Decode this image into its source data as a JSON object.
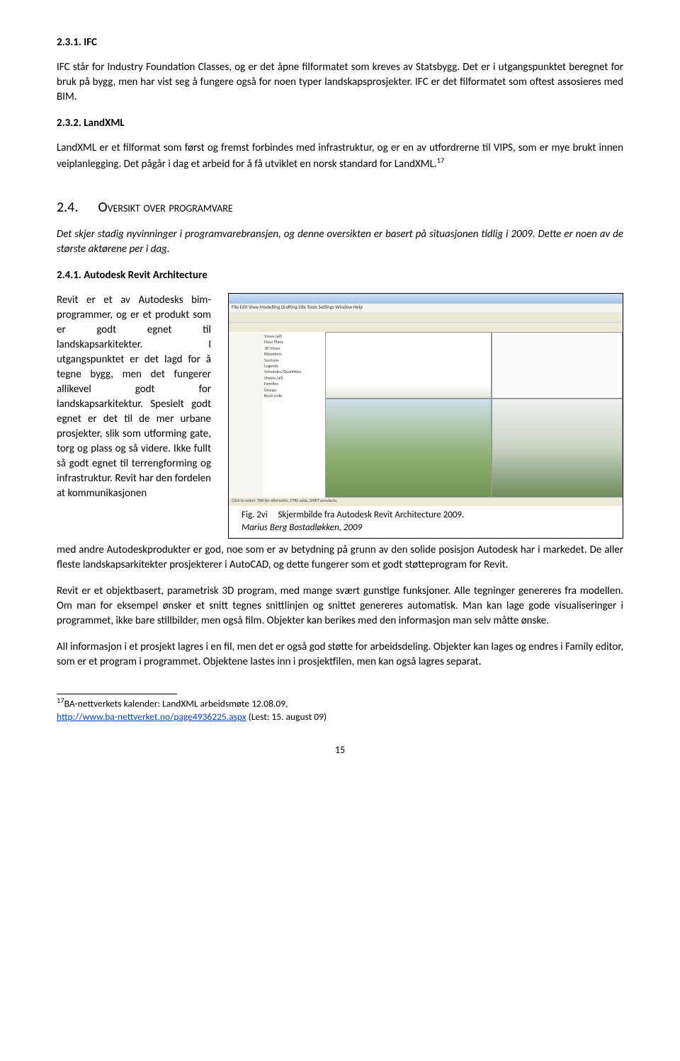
{
  "s1": {
    "heading": "2.3.1. IFC",
    "para": "IFC står for Industry Foundation Classes, og er det åpne filformatet som kreves av Statsbygg. Det er i utgangspunktet beregnet for bruk på bygg, men har vist seg å fungere også for noen typer landskapsprosjekter. IFC er det filformatet som oftest assosieres med BIM."
  },
  "s2": {
    "heading": "2.3.2. LandXML",
    "para": "LandXML er et filformat som først og fremst forbindes med infrastruktur, og er en av utfordrerne til VIPS, som er mye brukt innen veiplanlegging. Det pågår i dag et arbeid for å få utviklet en norsk standard for LandXML.",
    "ref": "17"
  },
  "s3": {
    "num": "2.4.",
    "title": "Oversikt over programvare",
    "intro": "Det skjer stadig nyvinninger i programvarebransjen, og denne oversikten er basert på situasjonen tidlig i 2009. Dette er noen av de største aktørene per i dag."
  },
  "s4": {
    "heading": "2.4.1. Autodesk Revit Architecture",
    "col": "Revit er et av Autodesks bim-programmer, og er et produkt som er godt egnet til landskapsarkitekter. I utgangspunktet er det lagd for å tegne bygg, men det fungerer allikevel godt for landskapsarkitektur. Spesielt godt egnet er det til de mer urbane prosjekter, slik som utforming gate, torg og plass og så videre. Ikke fullt så godt egnet til terrengforming og infrastruktur. Revit har den fordelen at kommunikasjonen",
    "after": "med andre Autodeskprodukter er god, noe som er av betydning på grunn av den solide posisjon Autodesk har i markedet. De aller fleste landskapsarkitekter prosjekterer i AutoCAD, og dette fungerer som et godt støtteprogram for Revit.",
    "p2": "Revit er et objektbasert, parametrisk 3D program, med mange svært gunstige funksjoner. Alle tegninger genereres fra modellen. Om man for eksempel ønsker et snitt tegnes snittlinjen og snittet genereres automatisk. Man kan lage gode visualiseringer i programmet, ikke bare stillbilder, men også film. Objekter kan berikes med den informasjon man selv måtte ønske.",
    "p3": "All informasjon i et prosjekt lagres i en fil, men det er også god støtte for arbeidsdeling. Objekter kan lages og endres i Family editor, som er et program i programmet. Objektene lastes inn i prosjektfilen, men kan også lagres separat."
  },
  "fig": {
    "label": "Fig. 2vi",
    "caption": "Skjermbilde fra Autodesk Revit Architecture 2009.",
    "source": "Marius Berg Bostadløkken, 2009",
    "menu": "File  Edit  View  Modelling  Drafting  Site  Tools  Settings  Window  Help",
    "status": "Click to select, TAB for alternates, CTRL adds, SHIFT unselects.",
    "tree": [
      "Views (all)",
      "Floor Plans",
      "3D Views",
      "Elevations",
      "Sections",
      "Legends",
      "Schedules/Quantities",
      "Sheets (all)",
      "Families",
      "Groups",
      "Revit Links"
    ]
  },
  "footnote": {
    "num": "17",
    "text": "BA-nettverkets kalender: LandXML arbeidsmøte 12.08.09,",
    "url": "http://www.ba-nettverket.no/page4936225.aspx",
    "tail": " (Lest: 15. august 09)"
  },
  "page": "15"
}
